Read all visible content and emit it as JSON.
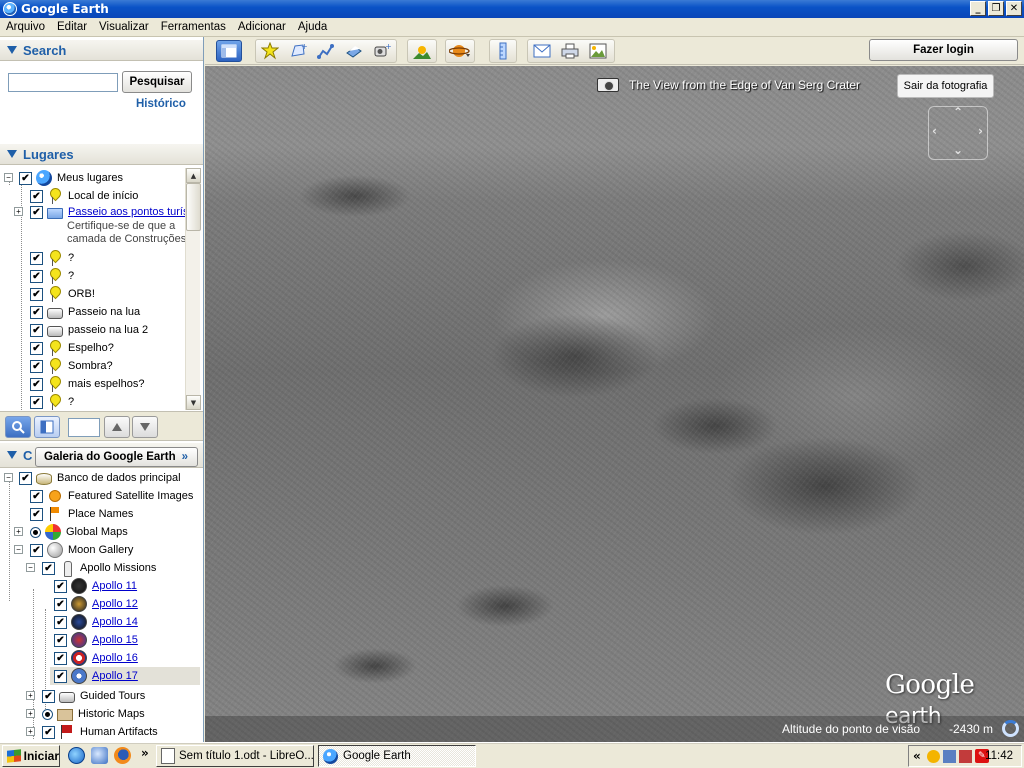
{
  "window": {
    "title": "Google Earth"
  },
  "menu": [
    "Arquivo",
    "Editar",
    "Visualizar",
    "Ferramentas",
    "Adicionar",
    "Ajuda"
  ],
  "search": {
    "header": "Search",
    "button": "Pesquisar",
    "history": "Histórico",
    "query": ""
  },
  "places": {
    "header": "Lugares",
    "root": "Meus lugares",
    "items": [
      "Local de início",
      "Passeio aos pontos turís",
      "Certifique-se de que a",
      "camada de Construções",
      "?",
      "?",
      "ORB!",
      "Passeio na lua",
      "passeio na lua 2",
      "Espelho?",
      "Sombra?",
      "mais espelhos?",
      "?"
    ]
  },
  "layers": {
    "header_initial": "C",
    "gallery_button": "Galeria do Google Earth",
    "root": "Banco de dados principal",
    "items": [
      "Featured Satellite Images",
      "Place Names",
      "Global Maps",
      "Moon Gallery",
      "Apollo Missions",
      "Apollo 11",
      "Apollo 12",
      "Apollo 14",
      "Apollo 15",
      "Apollo 16",
      "Apollo 17",
      "Guided Tours",
      "Historic Maps",
      "Human Artifacts"
    ]
  },
  "toolbar": {
    "login": "Fazer login"
  },
  "viewport": {
    "photo_title": "The View from the Edge of Van Serg Crater",
    "exit_photo": "Sair da fotografia",
    "logo_google": "Google",
    "logo_earth": "earth",
    "altitude_label": "Altitude do ponto de visão",
    "altitude_value": "-2430 m"
  },
  "taskbar": {
    "start": "Iniciar",
    "tasks": [
      "Sem título 1.odt - LibreO...",
      "Google Earth"
    ],
    "more": "»",
    "tray_more": "«",
    "clock": "11:42"
  }
}
